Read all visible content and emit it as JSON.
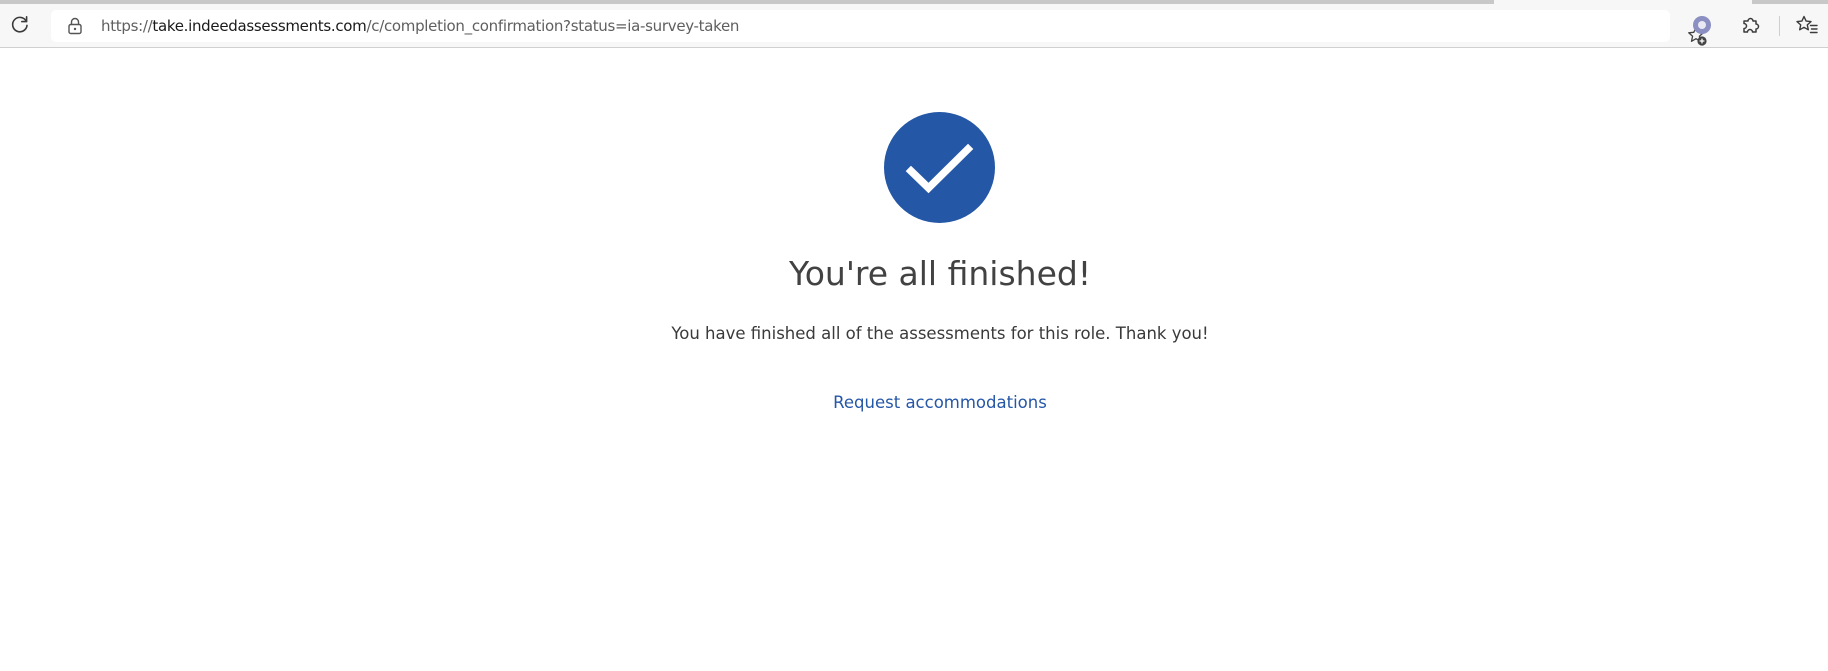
{
  "browser": {
    "url_scheme": "https://",
    "url_host": "take.indeedassessments.com",
    "url_path": "/c/completion_confirmation?status=ia-survey-taken",
    "icons": {
      "reload": "reload-icon",
      "lock": "lock-icon",
      "add_favorite": "star-plus-icon",
      "profile": "profile-circle-icon",
      "extensions": "puzzle-piece-icon",
      "favorites": "favorites-list-icon"
    }
  },
  "page": {
    "status_icon": "checkmark-circle-icon",
    "heading": "You're all finished!",
    "message": "You have finished all of the assessments for this role. Thank you!",
    "link_label": "Request accommodations"
  },
  "colors": {
    "accent": "#2557a7",
    "heading_text": "#424242",
    "body_text": "#3a3a3a"
  }
}
